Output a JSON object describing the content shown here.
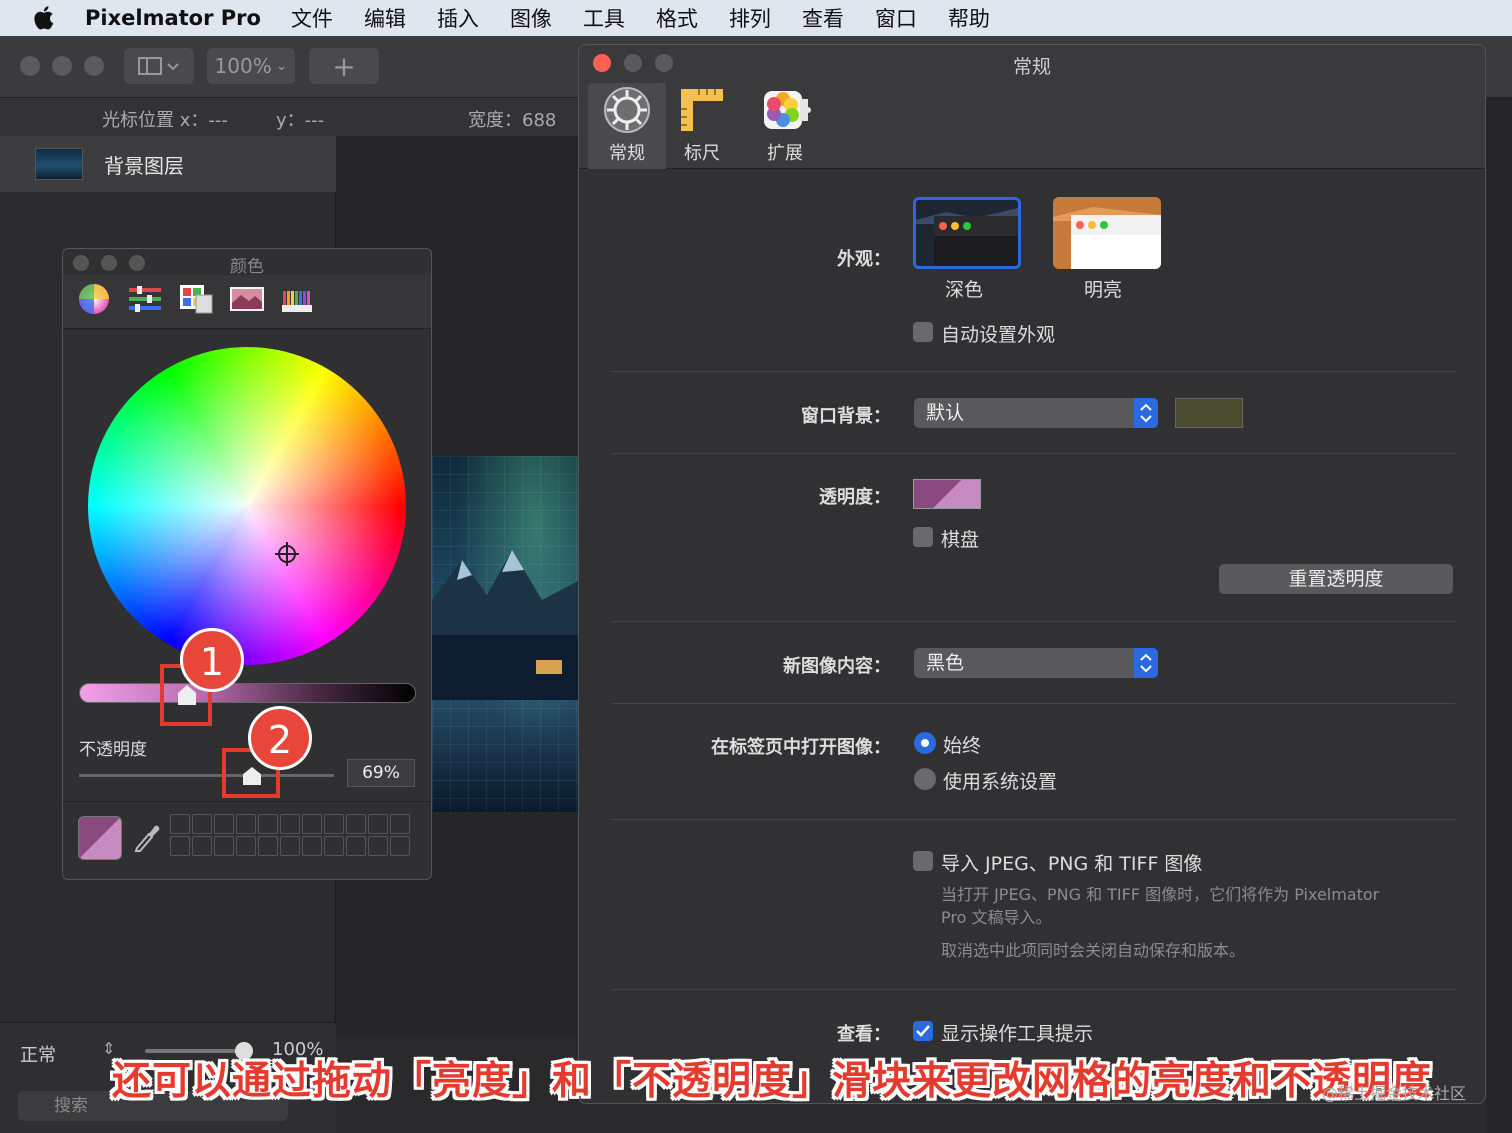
{
  "menubar": {
    "app": "Pixelmator Pro",
    "items": [
      "文件",
      "编辑",
      "插入",
      "图像",
      "工具",
      "格式",
      "排列",
      "查看",
      "窗口",
      "帮助"
    ]
  },
  "toolbar": {
    "zoom": "100%",
    "add_label": "+"
  },
  "infobar": {
    "cursor_x": "光标位置 x：---",
    "cursor_y": "y：---",
    "width": "宽度：688"
  },
  "layers": {
    "background_layer": "背景图层",
    "blend_mode": "正常",
    "opacity": "100%",
    "search_placeholder": "搜索"
  },
  "color_panel": {
    "title": "颜色",
    "tabs": [
      "color-wheel-icon",
      "sliders-icon",
      "palettes-icon",
      "image-palette-icon",
      "pencils-icon"
    ],
    "opacity_label": "不透明度",
    "opacity_value": "69%",
    "brightness_level": 0.3,
    "opacity_level": 0.69,
    "current_color": "#8a4a80"
  },
  "annotations": {
    "badge1": "1",
    "badge2": "2"
  },
  "prefs": {
    "title": "常规",
    "tabs": [
      {
        "label": "常规",
        "icon": "gear-icon"
      },
      {
        "label": "标尺",
        "icon": "ruler-icon"
      },
      {
        "label": "扩展",
        "icon": "extensions-icon"
      }
    ],
    "appearance_label": "外观：",
    "appearance_dark": "深色",
    "appearance_light": "明亮",
    "auto_appearance": "自动设置外观",
    "window_bg_label": "窗口背景：",
    "window_bg_value": "默认",
    "window_bg_color": "#4a4b2e",
    "transparency_label": "透明度：",
    "checkerboard": "棋盘",
    "reset_transparency": "重置透明度",
    "new_image_label": "新图像内容：",
    "new_image_value": "黑色",
    "open_tabs_label": "在标签页中打开图像：",
    "open_tabs_always": "始终",
    "open_tabs_system": "使用系统设置",
    "import_label": "导入 JPEG、PNG 和 TIFF 图像",
    "import_note_1": "当打开 JPEG、PNG 和 TIFF 图像时，它们将作为 Pixelmator",
    "import_note_2": "Pro 文稿导入。",
    "import_note_3": "取消选中此项同时会关闭自动保存和版本。",
    "view_label": "查看：",
    "show_tooltips": "显示操作工具提示"
  },
  "caption": "还可以通过拖动「亮度」和「不透明度」滑块来更改网格的亮度和不透明度",
  "watermark": "@稀土掘金技术社区",
  "accent_color": "#2a6ae0",
  "highlight_color": "#e53b2f"
}
